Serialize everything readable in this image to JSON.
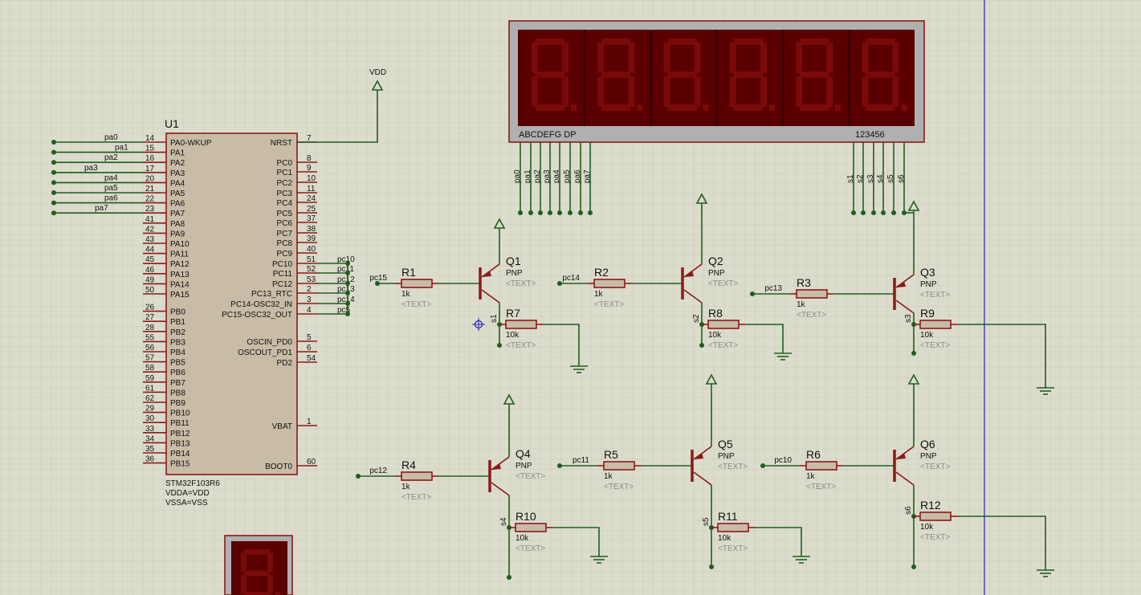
{
  "mcu": {
    "ref": "U1",
    "part": "STM32F103R6",
    "power1": "VDDA=VDD",
    "power2": "VSSA=VSS",
    "left_pins": [
      {
        "num": "14",
        "name": "PA0-WKUP"
      },
      {
        "num": "15",
        "name": "PA1"
      },
      {
        "num": "16",
        "name": "PA2"
      },
      {
        "num": "17",
        "name": "PA3"
      },
      {
        "num": "20",
        "name": "PA4"
      },
      {
        "num": "21",
        "name": "PA5"
      },
      {
        "num": "22",
        "name": "PA6"
      },
      {
        "num": "23",
        "name": "PA7"
      },
      {
        "num": "41",
        "name": "PA8"
      },
      {
        "num": "42",
        "name": "PA9"
      },
      {
        "num": "43",
        "name": "PA10"
      },
      {
        "num": "44",
        "name": "PA11"
      },
      {
        "num": "45",
        "name": "PA12"
      },
      {
        "num": "46",
        "name": "PA13"
      },
      {
        "num": "49",
        "name": "PA14"
      },
      {
        "num": "50",
        "name": "PA15"
      },
      {
        "num": "26",
        "name": "PB0"
      },
      {
        "num": "27",
        "name": "PB1"
      },
      {
        "num": "28",
        "name": "PB2"
      },
      {
        "num": "55",
        "name": "PB3"
      },
      {
        "num": "56",
        "name": "PB4"
      },
      {
        "num": "57",
        "name": "PB5"
      },
      {
        "num": "58",
        "name": "PB6"
      },
      {
        "num": "59",
        "name": "PB7"
      },
      {
        "num": "61",
        "name": "PB8"
      },
      {
        "num": "62",
        "name": "PB9"
      },
      {
        "num": "29",
        "name": "PB10"
      },
      {
        "num": "30",
        "name": "PB11"
      },
      {
        "num": "33",
        "name": "PB12"
      },
      {
        "num": "34",
        "name": "PB13"
      },
      {
        "num": "35",
        "name": "PB14"
      },
      {
        "num": "36",
        "name": "PB15"
      }
    ],
    "right_pins": [
      {
        "num": "7",
        "name": "NRST"
      },
      {
        "num": "8",
        "name": "PC0"
      },
      {
        "num": "9",
        "name": "PC1"
      },
      {
        "num": "10",
        "name": "PC2"
      },
      {
        "num": "11",
        "name": "PC3"
      },
      {
        "num": "24",
        "name": "PC4"
      },
      {
        "num": "25",
        "name": "PC5"
      },
      {
        "num": "37",
        "name": "PC6"
      },
      {
        "num": "38",
        "name": "PC7"
      },
      {
        "num": "39",
        "name": "PC8"
      },
      {
        "num": "40",
        "name": "PC9"
      },
      {
        "num": "51",
        "name": "PC10"
      },
      {
        "num": "52",
        "name": "PC11"
      },
      {
        "num": "53",
        "name": "PC12"
      },
      {
        "num": "2",
        "name": "PC13_RTC"
      },
      {
        "num": "3",
        "name": "PC14-OSC32_IN"
      },
      {
        "num": "4",
        "name": "PC15-OSC32_OUT"
      },
      {
        "num": "5",
        "name": "OSCIN_PD0"
      },
      {
        "num": "6",
        "name": "OSCOUT_PD1"
      },
      {
        "num": "54",
        "name": "PD2"
      },
      {
        "num": "1",
        "name": "VBAT"
      },
      {
        "num": "60",
        "name": "BOOT0"
      }
    ],
    "pa_nets": [
      "pa0",
      "pa1",
      "pa2",
      "pa3",
      "pa4",
      "pa5",
      "pa6",
      "pa7"
    ],
    "pc_nets": [
      "pc10",
      "pc11",
      "pc12",
      "pc13",
      "pc14",
      "pc5"
    ]
  },
  "vdd_label": "VDD",
  "display": {
    "segment_labels": "ABCDEFG DP",
    "digit_labels": "123456",
    "seg_nets": [
      "pa0",
      "pa1",
      "pa2",
      "pa3",
      "pa4",
      "pa5",
      "pa6",
      "pa7"
    ],
    "digit_nets": [
      "s1",
      "s2",
      "s3",
      "s4",
      "s5",
      "s6"
    ]
  },
  "transistors": [
    {
      "ref": "Q1",
      "type": "PNP",
      "text": "<TEXT>",
      "base_ref": "R1",
      "base_val": "1k",
      "base_net": "pc15",
      "pull_ref": "R7",
      "pull_val": "10k",
      "emit_net": "s1"
    },
    {
      "ref": "Q2",
      "type": "PNP",
      "text": "<TEXT>",
      "base_ref": "R2",
      "base_val": "1k",
      "base_net": "pc14",
      "pull_ref": "R8",
      "pull_val": "10k",
      "emit_net": "s2"
    },
    {
      "ref": "Q3",
      "type": "PNP",
      "text": "<TEXT>",
      "base_ref": "R3",
      "base_val": "1k",
      "base_net": "pc13",
      "pull_ref": "R9",
      "pull_val": "10k",
      "emit_net": "s3"
    },
    {
      "ref": "Q4",
      "type": "PNP",
      "text": "<TEXT>",
      "base_ref": "R4",
      "base_val": "1k",
      "base_net": "pc12",
      "pull_ref": "R10",
      "pull_val": "10k",
      "emit_net": "s4"
    },
    {
      "ref": "Q5",
      "type": "PNP",
      "text": "<TEXT>",
      "base_ref": "R5",
      "base_val": "1k",
      "base_net": "pc11",
      "pull_ref": "R11",
      "pull_val": "10k",
      "emit_net": "s5"
    },
    {
      "ref": "Q6",
      "type": "PNP",
      "text": "<TEXT>",
      "base_ref": "R6",
      "base_val": "1k",
      "base_net": "pc10",
      "pull_ref": "R12",
      "pull_val": "10k",
      "emit_net": "s6"
    }
  ],
  "resistor_text": "<TEXT>",
  "colors": {
    "wire": "#1f5e1f",
    "component": "#8b1a1a",
    "body_fill": "#c8bca6",
    "display_fill": "#5a0000",
    "grid": "#c9c9b9",
    "sheet_edge": "#1f1fb4"
  }
}
